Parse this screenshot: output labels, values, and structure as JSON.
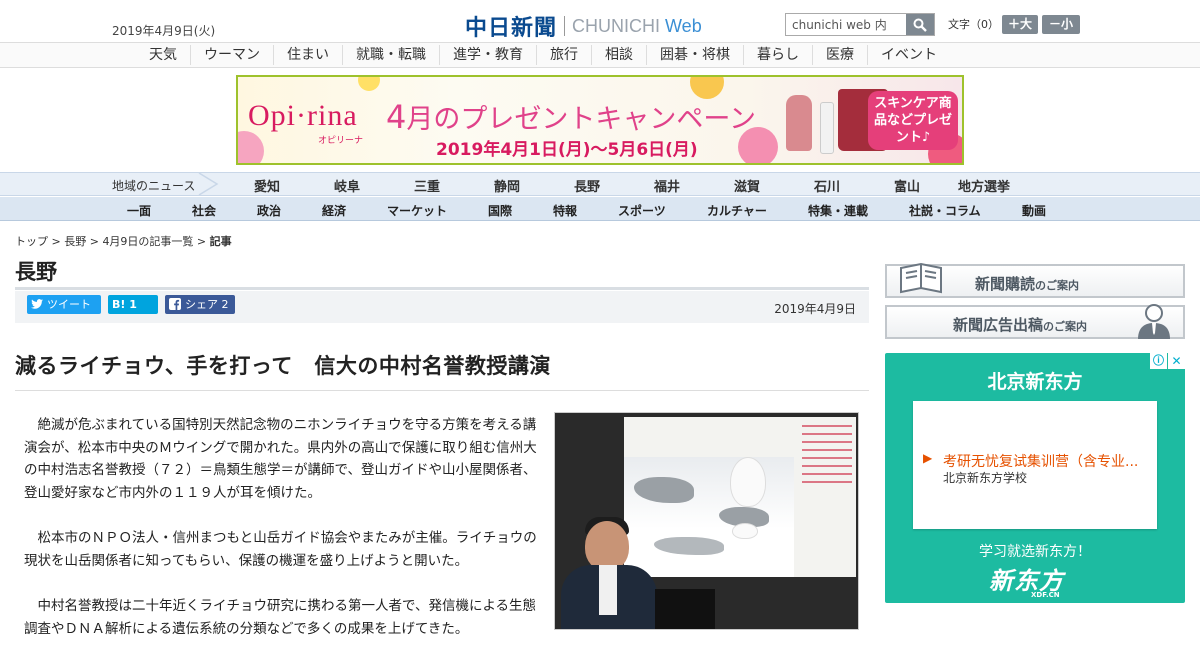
{
  "header": {
    "date": "2019年4月9日(火)",
    "logo_jp": "中日新聞",
    "logo_en": "CHUNICHI",
    "logo_web": "Web",
    "search_value": "chunichi web 内",
    "fontsize_label": "文字（0）",
    "font_larger": "＋大",
    "font_smaller": "－小"
  },
  "category_nav": [
    "天気",
    "ウーマン",
    "住まい",
    "就職・転職",
    "進学・教育",
    "旅行",
    "相談",
    "囲碁・将棋",
    "暮らし",
    "医療",
    "イベント"
  ],
  "banner": {
    "brand": "Opi·rina",
    "brand_sub": "オピリーナ",
    "title_month": "4",
    "title_rest": "月のプレゼントキャンペーン",
    "dates": "2019年4月1日(月)〜5月6日(月)",
    "note": "スキンケア商品などプレゼント♪"
  },
  "region_nav": {
    "label": "地域のニュース",
    "items": [
      "愛知",
      "岐阜",
      "三重",
      "静岡",
      "長野",
      "福井",
      "滋賀",
      "石川",
      "富山",
      "地方選挙"
    ]
  },
  "section_nav": [
    "一面",
    "社会",
    "政治",
    "経済",
    "マーケット",
    "国際",
    "特報",
    "スポーツ",
    "カルチャー",
    "特集・連載",
    "社説・コラム",
    "動画"
  ],
  "breadcrumb": {
    "top": "トップ",
    "region": "長野",
    "list": "4月9日の記事一覧",
    "current": "記事",
    "sep": " > "
  },
  "region_title": "長野",
  "share": {
    "tweet": "ツイート",
    "hatena_count": "1",
    "facebook": "シェア",
    "facebook_count": "2",
    "date": "2019年4月9日"
  },
  "article": {
    "headline": "減るライチョウ、手を打って　信大の中村名誉教授講演",
    "paragraphs": [
      "絶滅が危ぶまれている国特別天然記念物のニホンライチョウを守る方策を考える講演会が、松本市中央のＭウイングで開かれた。県内外の高山で保護に取り組む信州大の中村浩志名誉教授（７２）＝鳥類生態学＝が講師で、登山ガイドや山小屋関係者、登山愛好家など市内外の１１９人が耳を傾けた。",
      "松本市のＮＰＯ法人・信州まつもと山岳ガイド協会やまたみが主催。ライチョウの現状を山岳関係者に知ってもらい、保護の機運を盛り上げようと開いた。",
      "中村名誉教授は二十年近くライチョウ研究に携わる第一人者で、発信機による生態調査やＤＮＡ解析による遺伝系統の分類などで多くの成果を上げてきた。"
    ]
  },
  "sidebar": {
    "subscribe": "新聞購読",
    "subscribe_suffix": "のご案内",
    "advert": "新聞広告出稿",
    "advert_suffix": "のご案内"
  },
  "ad": {
    "title": "北京新东方",
    "link": "考研无忧复试集训营（含专业...",
    "school": "北京新东方学校",
    "cta": "学习就选新东方！",
    "logo": "新东方",
    "logo_sub": "XDF.CN",
    "info": "ⓘ",
    "close": "✕"
  },
  "colors": {
    "brand_blue": "#0a4a8f",
    "twitter": "#1da1f2",
    "hatena": "#00a4de",
    "facebook": "#3b5998",
    "ad_bg": "#1dbba1",
    "banner_pink": "#e0428a"
  }
}
